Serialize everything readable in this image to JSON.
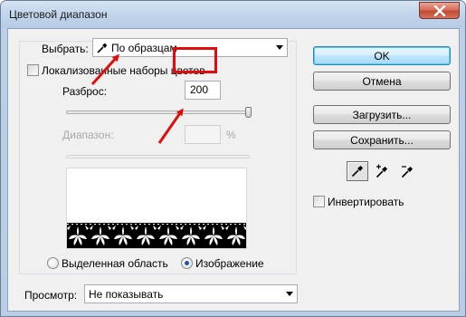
{
  "window": {
    "title": "Цветовой диапазон"
  },
  "select_row": {
    "label": "Выбрать:",
    "value": "По образцам",
    "icon": "eyedropper-icon"
  },
  "localized": {
    "label": "Локализованные наборы цветов",
    "checked": false
  },
  "fuzziness": {
    "label": "Разброс:",
    "value": "200",
    "slider_fraction": 1.0
  },
  "range": {
    "label": "Диапазон:",
    "value": "",
    "unit": "%"
  },
  "view_mode": {
    "selection_label": "Выделенная область",
    "image_label": "Изображение",
    "selected": "image"
  },
  "preview_row": {
    "label": "Просмотр:",
    "value": "Не показывать"
  },
  "buttons": {
    "ok": "OK",
    "cancel": "Отмена",
    "load": "Загрузить...",
    "save": "Сохранить..."
  },
  "invert": {
    "label": "Инвертировать",
    "checked": false
  },
  "tools": [
    "eyedropper-icon",
    "eyedropper-plus-icon",
    "eyedropper-minus-icon"
  ],
  "colors": {
    "annotation": "#e20c0c",
    "title_bar": "#c3d6ec",
    "dialog_bg": "#f0f0f0"
  }
}
